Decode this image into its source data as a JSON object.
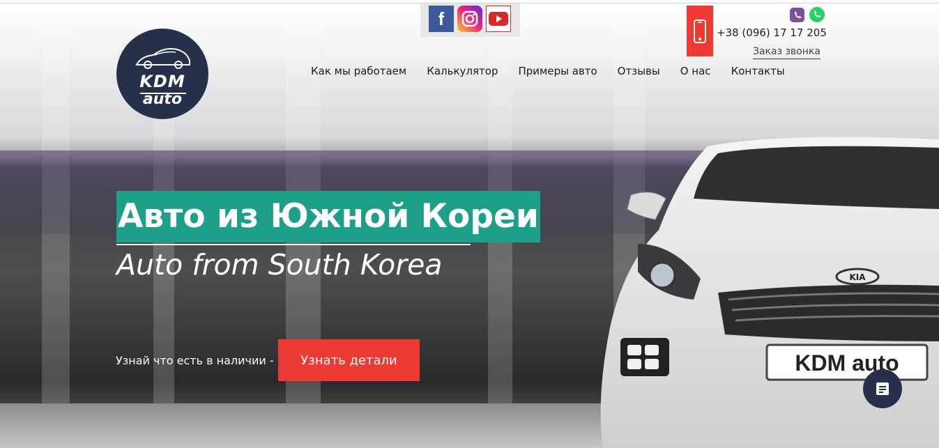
{
  "brand": {
    "logo_text_top": "KDM",
    "logo_text_bottom": "auto",
    "logo_color": "#27304a"
  },
  "social": [
    {
      "name": "facebook",
      "icon": "facebook-icon",
      "color": "#3b5998"
    },
    {
      "name": "instagram",
      "icon": "instagram-icon",
      "color": "#ee2a7b"
    },
    {
      "name": "youtube",
      "icon": "youtube-icon",
      "color": "#d62a2a"
    }
  ],
  "contact": {
    "phone": "+38 (096) 17 17 205",
    "callback_label": "Заказ звонка",
    "messengers": [
      "viber-icon",
      "whatsapp-icon"
    ],
    "accent": "#ef3a33"
  },
  "nav": {
    "items": [
      "Как мы работаем",
      "Калькулятор",
      "Примеры авто",
      "Отзывы",
      "О нас",
      "Контакты"
    ]
  },
  "hero": {
    "title": "Авто из Южной Кореи",
    "subtitle": "Auto from South Korea",
    "title_bg": "#1e9f8a",
    "availability_text": "Узнай что есть в наличии -",
    "cta_label": "Узнать детали",
    "plate_text": "KDM auto",
    "car_badge": "KIA"
  },
  "chat": {
    "icon": "chat-icon"
  }
}
